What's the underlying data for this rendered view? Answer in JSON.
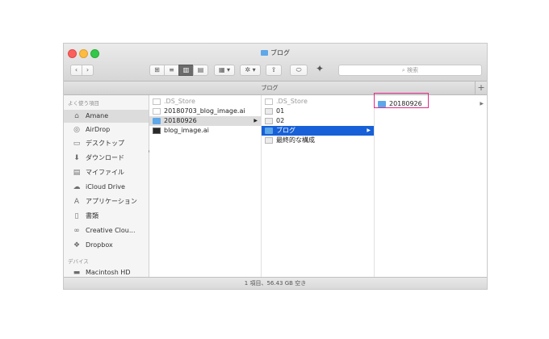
{
  "window": {
    "title": "ブログ",
    "path_title": "ブログ",
    "search_placeholder": "検索",
    "plus_label": "+",
    "status": "1 項目、56.43 GB 空き"
  },
  "toolbar": {
    "back": "‹",
    "forward": "›",
    "view_icons": "⊞",
    "view_list": "≡",
    "view_columns": "▥",
    "view_gallery": "▤",
    "arrange": "▦ ▾",
    "action": "✲ ▾",
    "share": "⇪",
    "tag": "⬭",
    "app": "✦"
  },
  "sidebar": {
    "favorites_header": "よく使う項目",
    "devices_header": "デバイス",
    "items": [
      {
        "label": "Amane",
        "icon": "home-icon",
        "glyph": "⌂"
      },
      {
        "label": "AirDrop",
        "icon": "airdrop-icon",
        "glyph": "◎"
      },
      {
        "label": "デスクトップ",
        "icon": "desktop-icon",
        "glyph": "▭"
      },
      {
        "label": "ダウンロード",
        "icon": "download-icon",
        "glyph": "⬇"
      },
      {
        "label": "マイファイル",
        "icon": "all-files-icon",
        "glyph": "▤"
      },
      {
        "label": "iCloud Drive",
        "icon": "cloud-icon",
        "glyph": "☁"
      },
      {
        "label": "アプリケーション",
        "icon": "applications-icon",
        "glyph": "A"
      },
      {
        "label": "書類",
        "icon": "documents-icon",
        "glyph": "▯"
      },
      {
        "label": "Creative Clou...",
        "icon": "creative-cloud-icon",
        "glyph": "∞"
      },
      {
        "label": "Dropbox",
        "icon": "dropbox-icon",
        "glyph": "❖"
      }
    ],
    "devices": [
      {
        "label": "Macintosh HD",
        "icon": "disk-icon",
        "glyph": "▬"
      }
    ]
  },
  "columns": {
    "col1": [
      {
        "label": ".DS_Store",
        "type": "doc"
      },
      {
        "label": "20180703_blog_image.ai",
        "type": "doc"
      },
      {
        "label": "20180926",
        "type": "folder"
      },
      {
        "label": "blog_image.ai",
        "type": "ai"
      }
    ],
    "col2": [
      {
        "label": ".DS_Store",
        "type": "doc"
      },
      {
        "label": "01",
        "type": "box"
      },
      {
        "label": "02",
        "type": "box"
      },
      {
        "label": "ブログ",
        "type": "folder"
      },
      {
        "label": "最終的な構成",
        "type": "box"
      }
    ],
    "col3": [
      {
        "label": "20180926",
        "type": "folder"
      }
    ],
    "chevron": "▶"
  },
  "colors": {
    "selection": "#1760d8",
    "folder": "#5ea7e8",
    "annotation": "#e02a8a"
  }
}
